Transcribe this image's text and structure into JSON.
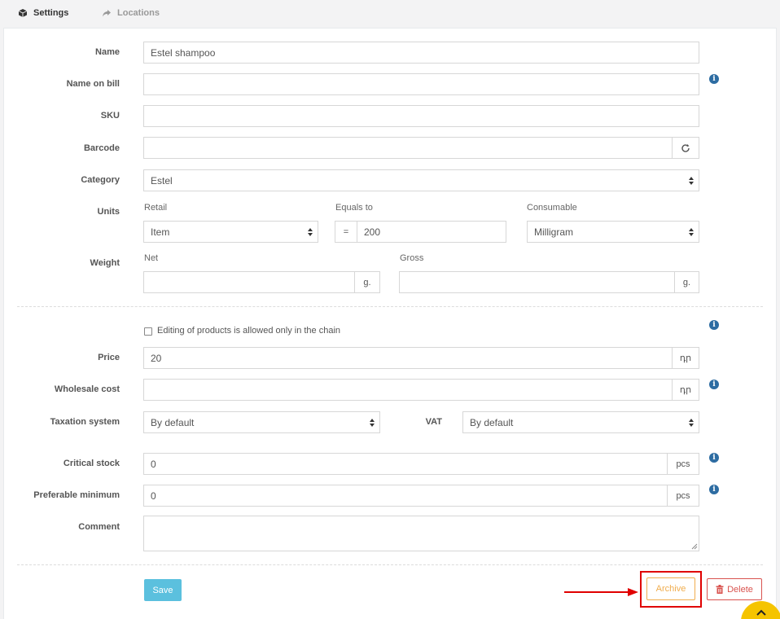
{
  "tabs": [
    {
      "label": "Settings",
      "icon": "cube-icon",
      "active": true
    },
    {
      "label": "Locations",
      "icon": "share-arrow-icon",
      "active": false
    }
  ],
  "form": {
    "name": {
      "label": "Name",
      "value": "Estel shampoo"
    },
    "name_on_bill": {
      "label": "Name on bill",
      "value": ""
    },
    "sku": {
      "label": "SKU",
      "value": ""
    },
    "barcode": {
      "label": "Barcode",
      "value": ""
    },
    "category": {
      "label": "Category",
      "value": "Estel"
    },
    "units": {
      "label": "Units",
      "retail_label": "Retail",
      "retail_value": "Item",
      "equals_label": "Equals to",
      "equals_sign": "=",
      "equals_value": "200",
      "consumable_label": "Consumable",
      "consumable_value": "Milligram"
    },
    "weight": {
      "label": "Weight",
      "net_label": "Net",
      "net_value": "",
      "net_unit": "g.",
      "gross_label": "Gross",
      "gross_value": "",
      "gross_unit": "g."
    },
    "chain_checkbox": {
      "label": "Editing of products is allowed only in the chain",
      "checked": false
    },
    "price": {
      "label": "Price",
      "value": "20",
      "currency": "դր"
    },
    "wholesale_cost": {
      "label": "Wholesale cost",
      "value": "",
      "currency": "դր"
    },
    "taxation": {
      "label": "Taxation system",
      "value": "By default"
    },
    "vat": {
      "label": "VAT",
      "value": "By default"
    },
    "critical_stock": {
      "label": "Critical stock",
      "value": "0",
      "unit": "pcs"
    },
    "preferable_minimum": {
      "label": "Preferable minimum",
      "value": "0",
      "unit": "pcs"
    },
    "comment": {
      "label": "Comment",
      "value": ""
    }
  },
  "actions": {
    "save": "Save",
    "archive": "Archive",
    "delete": "Delete"
  },
  "colors": {
    "save": "#5bc0de",
    "archive": "#f0ad4e",
    "delete": "#d9534f",
    "info": "#2d6ca2",
    "highlight": "#e00000",
    "fab": "#f5c400"
  }
}
